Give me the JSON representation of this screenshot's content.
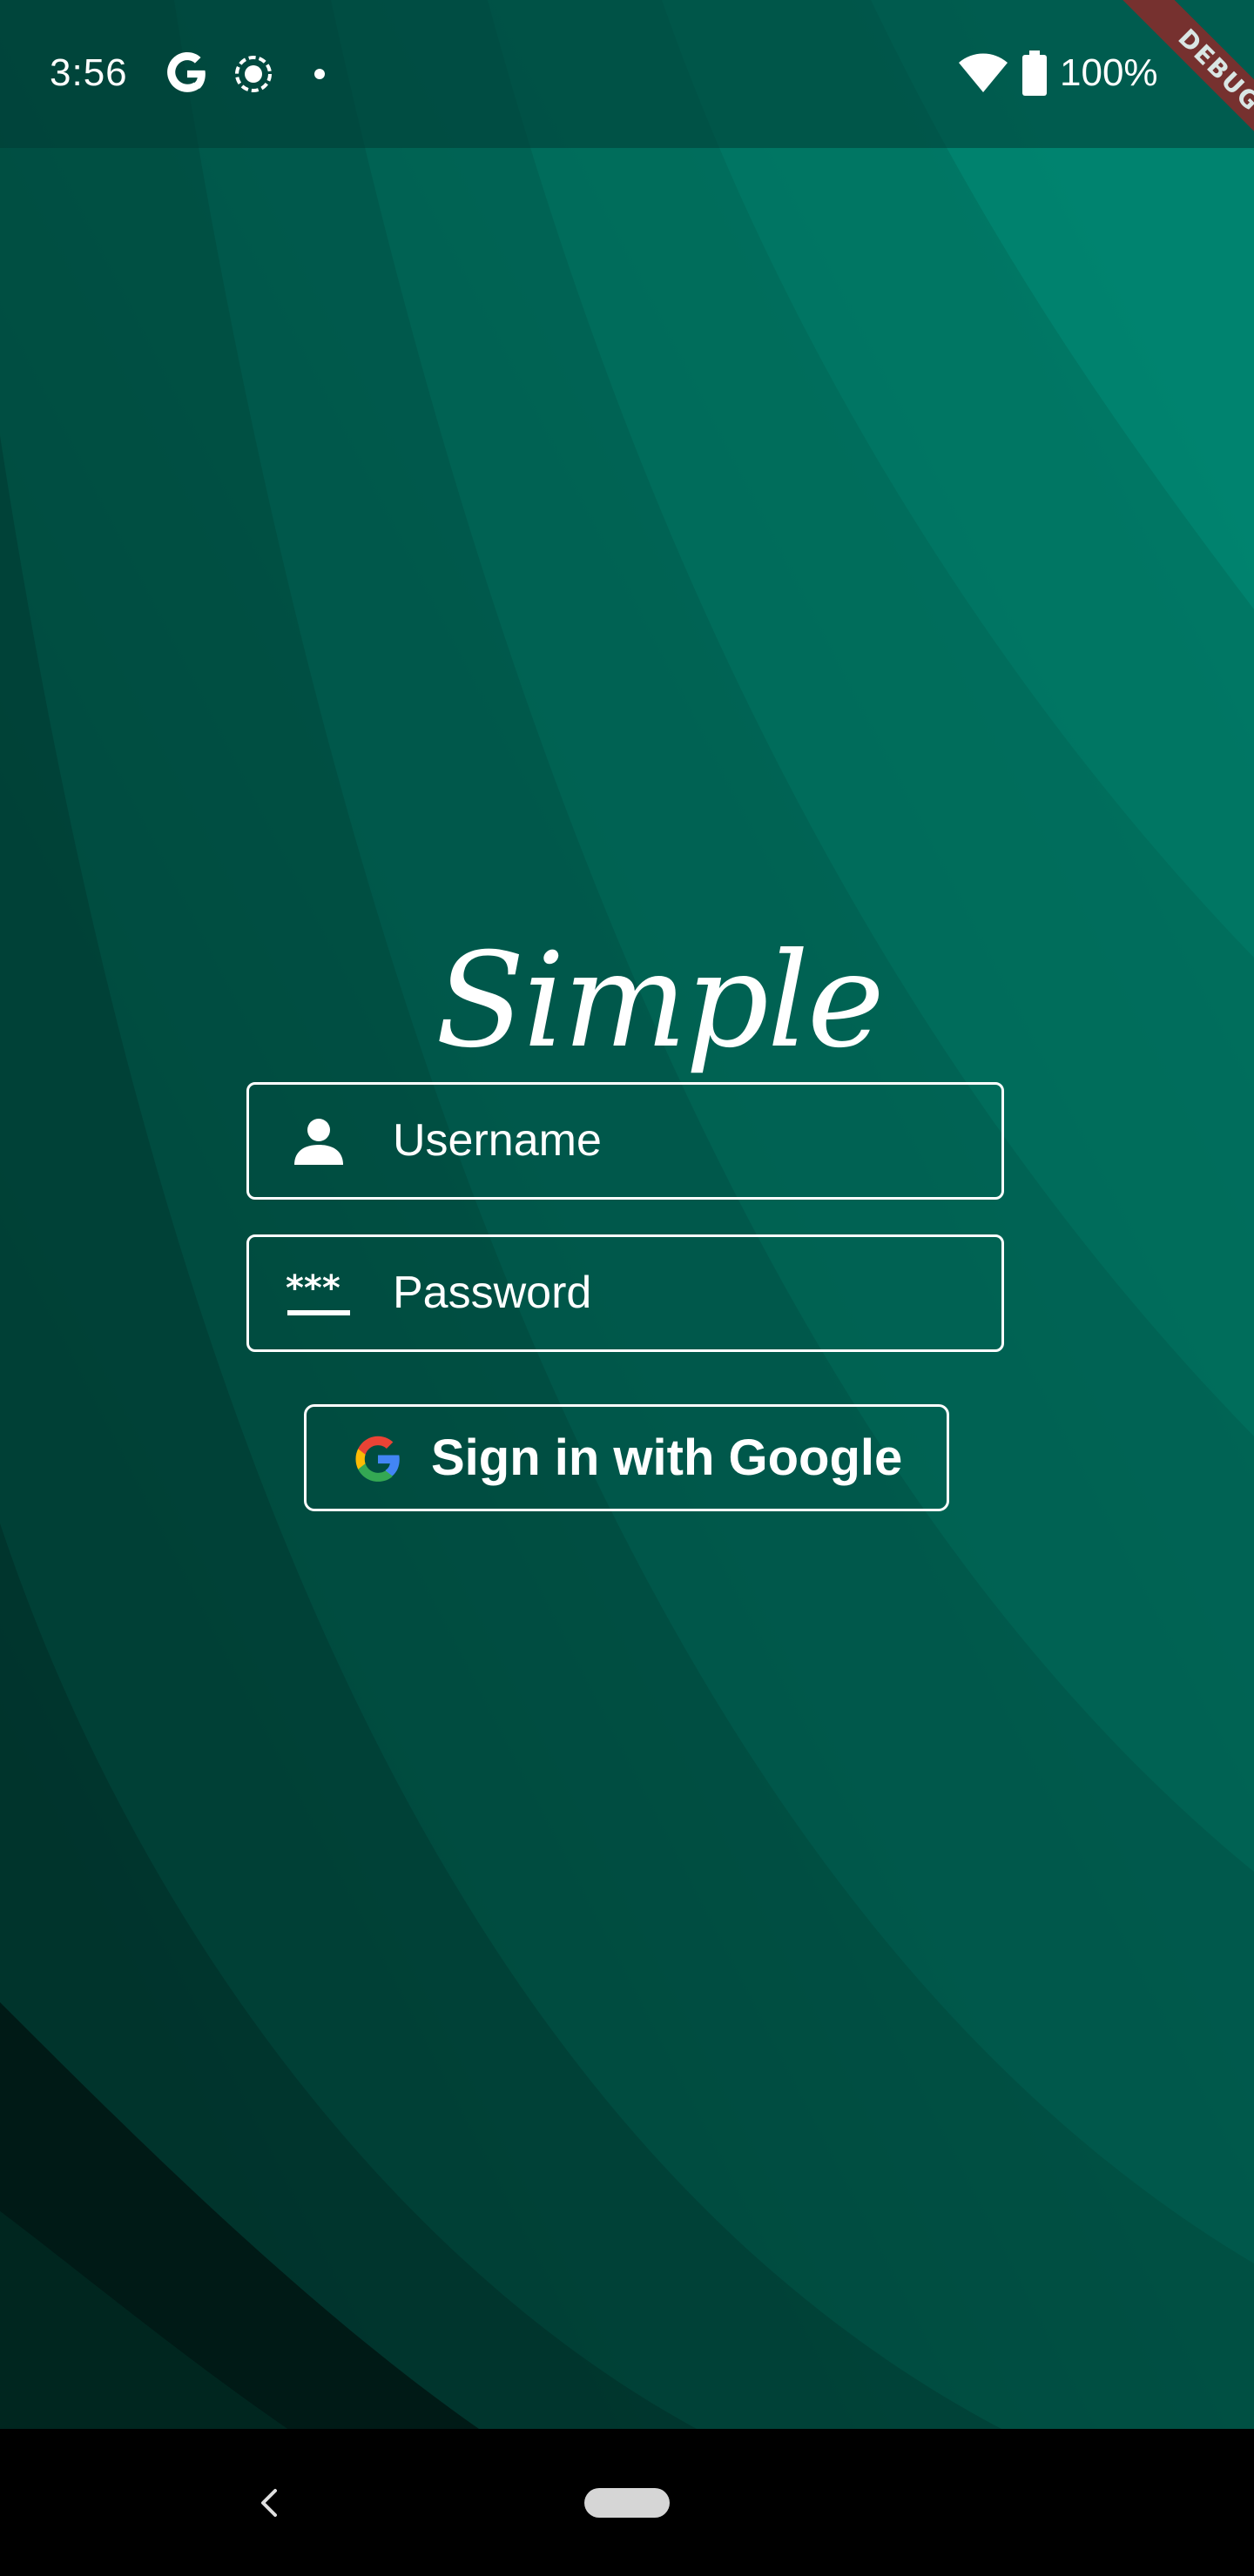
{
  "status_bar": {
    "time": "3:56",
    "icons": [
      "google-g-icon",
      "record-icon",
      "dot-icon",
      "wifi-icon",
      "battery-icon"
    ],
    "battery": "100%"
  },
  "debug_banner": "DEBUG",
  "app": {
    "logo": "Simple"
  },
  "login_form": {
    "username_placeholder": "Username",
    "password_placeholder": "Password",
    "google_button_label": "Sign in with Google"
  },
  "colors": {
    "background_dark": "#003a33",
    "background_teal": "#007a68",
    "text": "#ffffff",
    "debug_ribbon": "#8b2a2a",
    "nav_bar": "#000000"
  },
  "navigation": {
    "icons": [
      "back-icon",
      "home-pill"
    ]
  }
}
